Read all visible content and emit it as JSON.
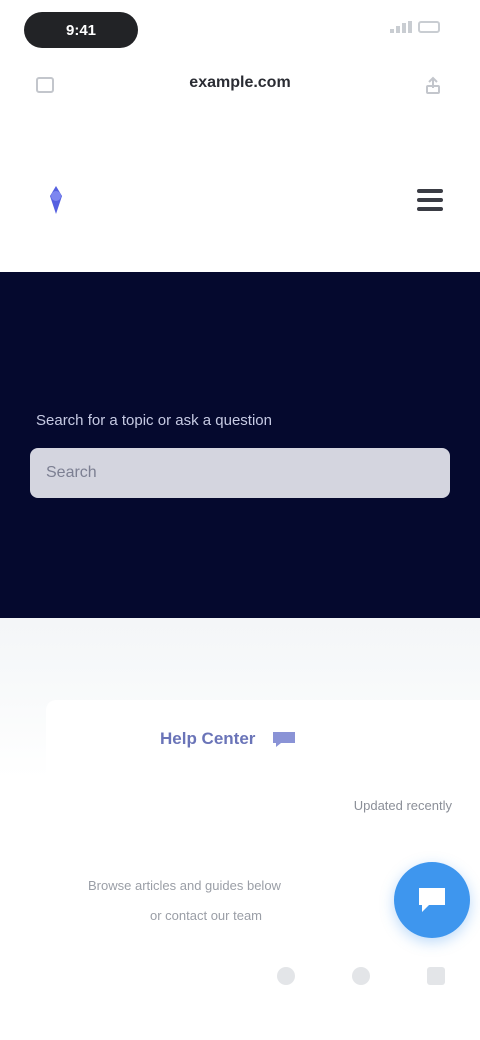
{
  "status_bar": {
    "time": "9:41",
    "icons": [
      "signal-icon",
      "battery-icon"
    ]
  },
  "browser": {
    "url": "example.com",
    "left_icon": "tabs-icon",
    "right_icon": "share-icon"
  },
  "header": {
    "logo_icon": "logo-icon",
    "menu_icon": "hamburger-menu-icon"
  },
  "hero": {
    "line": "Search for a topic or ask a question",
    "search_placeholder": "Search"
  },
  "content": {
    "brand": "Help Center",
    "meta": "Updated recently",
    "desc_line1": "Browse articles and guides below",
    "desc_line2": "or contact our team"
  },
  "chat_button": {
    "icon": "chat-icon"
  },
  "social": {
    "icons": [
      "facebook-icon",
      "twitter-icon",
      "linkedin-icon"
    ]
  },
  "colors": {
    "hero_bg": "#05092e",
    "accent": "#3e96ee",
    "brand": "#6a74b8"
  }
}
